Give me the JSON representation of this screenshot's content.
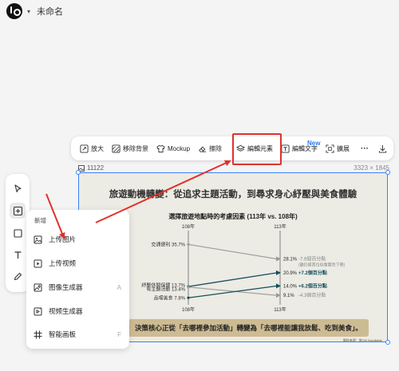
{
  "app": {
    "title": "未命名"
  },
  "toolbar": {
    "items": [
      {
        "label": "放大",
        "icon": "upscale-icon"
      },
      {
        "label": "移除背景",
        "icon": "remove-bg-icon"
      },
      {
        "label": "Mockup",
        "icon": "tshirt-icon"
      },
      {
        "label": "擦除",
        "icon": "eraser-icon"
      },
      {
        "label": "編輯元素",
        "icon": "layers-icon"
      },
      {
        "label": "編輯文字",
        "icon": "edit-text-icon"
      },
      {
        "label": "擴展",
        "icon": "expand-icon"
      },
      {
        "label": "···",
        "icon": "more-icon"
      },
      {
        "label": "",
        "icon": "download-icon"
      }
    ],
    "new_badge": "New"
  },
  "canvas": {
    "frame_label": "11122",
    "frame_size": "3323 × 1845",
    "slide_title": "旅遊動機轉變：從追求主題活動，到尋求身心紓壓與美食體驗",
    "conclusion": "決策核心正從「去哪裡參加活動」轉變為「去哪裡能讓我放鬆、吃到美食」。",
    "source": "資料來源：旅Ohi Noodlable"
  },
  "chart_data": {
    "type": "line",
    "subtype": "slope",
    "title": "選擇旅遊地點時的考慮因素 (113年 vs. 108年)",
    "x": [
      "108年",
      "113年"
    ],
    "series": [
      {
        "name": "交通便利",
        "values": [
          35.7,
          28.1
        ],
        "start_label": "35.7%",
        "end_label": "28.1%",
        "change": "-7.6個百分點",
        "note": "(雖仍居首位但重要性下降)",
        "color": "#9a9a9a"
      },
      {
        "name": "紓壓休閒保健",
        "values": [
          13.7,
          20.9
        ],
        "start_label": "13.7%",
        "end_label": "20.9%",
        "change": "+7.2個百分點",
        "color": "#134e5e"
      },
      {
        "name": "有主題活動",
        "values": [
          13.4,
          9.1
        ],
        "start_label": "13.4%",
        "end_label": "9.1%",
        "change": "-4.3個百分點",
        "color": "#9a9a9a"
      },
      {
        "name": "品嚐美食",
        "values": [
          7.8,
          14.0
        ],
        "start_label": "7.8%",
        "end_label": "14.0%",
        "change": "+6.2個百分點",
        "color": "#134e5e"
      }
    ],
    "ylim": [
      5,
      40
    ],
    "grid": false
  },
  "rail": {
    "tools": [
      {
        "name": "select-tool",
        "icon": "cursor-icon"
      },
      {
        "name": "add-tool",
        "icon": "plus-square-icon",
        "active": true
      },
      {
        "name": "shape-tool",
        "icon": "square-icon"
      },
      {
        "name": "text-tool",
        "icon": "text-icon"
      },
      {
        "name": "pen-tool",
        "icon": "pen-icon"
      }
    ]
  },
  "add_menu": {
    "header": "新增",
    "items": [
      {
        "label": "上传图片",
        "icon": "image-upload-icon",
        "shortcut": ""
      },
      {
        "label": "上传视频",
        "icon": "video-upload-icon",
        "shortcut": ""
      },
      {
        "label": "图像生成器",
        "icon": "image-generator-icon",
        "shortcut": "A"
      },
      {
        "label": "视频生成器",
        "icon": "video-generator-icon",
        "shortcut": ""
      },
      {
        "label": "智能画板",
        "icon": "smart-board-icon",
        "shortcut": "F"
      }
    ]
  },
  "colors": {
    "accent": "#3b82f6",
    "annotation": "#e0322b",
    "banner": "#cdbb93",
    "chart_up": "#134e5e",
    "chart_down": "#9a9a9a"
  }
}
